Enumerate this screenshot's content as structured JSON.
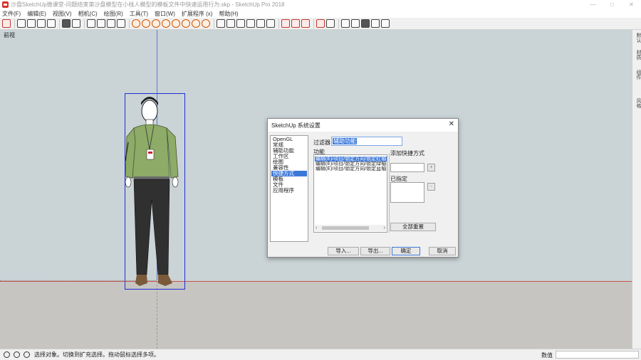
{
  "window": {
    "title": "沙盘SketchUp微课堂-问题结束第沙盘模型在小栈人模型的模板文件中快速运用行为.skp - SketchUp Pro 2018",
    "minimize": "—",
    "maximize": "□",
    "close": "✕"
  },
  "menu": {
    "items": [
      "文件(F)",
      "编辑(E)",
      "视图(V)",
      "相机(C)",
      "绘图(R)",
      "工具(T)",
      "窗口(W)",
      "扩展程序 (x)",
      "帮助(H)"
    ]
  },
  "viewport": {
    "scene_label": "前视"
  },
  "side_panel": {
    "tabs": [
      "默认",
      "材质",
      "组件",
      "风格"
    ]
  },
  "status": {
    "message": "选择对象。切换到扩充选择。拖动鼠标选择多项。",
    "measurement_label": "数值"
  },
  "dialog": {
    "title": "SketchUp 系统设置",
    "categories": [
      "OpenGL",
      "常规",
      "辅助功能",
      "工作区",
      "绘图",
      "兼容性",
      "快捷方式",
      "模板",
      "文件",
      "应用程序"
    ],
    "selected_category": "快捷方式",
    "filter_label": "过滤器",
    "filter_value": "辅助功能",
    "function_label": "功能",
    "functions": [
      "编辑(E)/项目/锁定方向/锁定红轴",
      "编辑(E)/项目/锁定方向/锁定绿轴",
      "编辑(E)/项目/锁定方向/锁定蓝轴"
    ],
    "add_shortcut_label": "添加快捷方式",
    "add_button": "+",
    "assigned_label": "已指定",
    "remove_button": "-",
    "reset_all_button": "全部重置",
    "import_button": "导入...",
    "export_button": "导出...",
    "ok_button": "确定",
    "cancel_button": "取消"
  },
  "colors": {
    "sky": "#cad3d6",
    "ground": "#c7c5c1",
    "red_axis": "#c9504a",
    "blue_axis": "#5b78d6",
    "selection": "#1e2fd8",
    "highlight": "#3c78d8"
  }
}
